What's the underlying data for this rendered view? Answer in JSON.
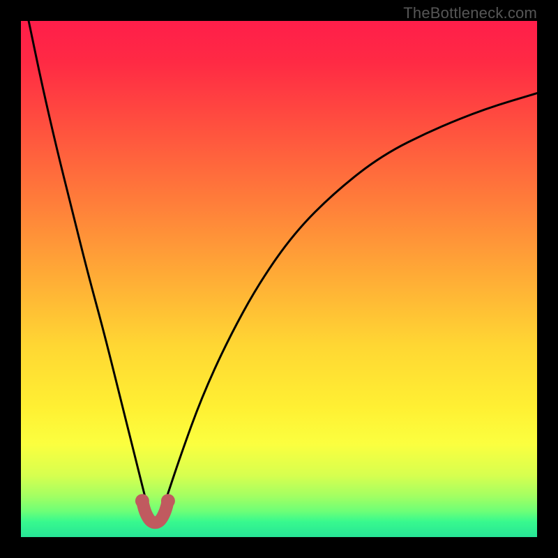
{
  "watermark": {
    "text": "TheBottleneck.com"
  },
  "chart_data": {
    "type": "line",
    "title": "",
    "xlabel": "",
    "ylabel": "",
    "x_range_pct": [
      0,
      100
    ],
    "y_range_pct": [
      0,
      100
    ],
    "minimum_x_pct": 26,
    "series": [
      {
        "name": "curve",
        "color": "#000000",
        "points_pct": [
          {
            "x": 1.5,
            "y": 100
          },
          {
            "x": 4,
            "y": 88
          },
          {
            "x": 7,
            "y": 75
          },
          {
            "x": 10,
            "y": 63
          },
          {
            "x": 13,
            "y": 51
          },
          {
            "x": 16,
            "y": 40
          },
          {
            "x": 19,
            "y": 28
          },
          {
            "x": 22,
            "y": 16
          },
          {
            "x": 24,
            "y": 8
          },
          {
            "x": 25,
            "y": 4
          },
          {
            "x": 26,
            "y": 3
          },
          {
            "x": 27,
            "y": 4
          },
          {
            "x": 28,
            "y": 7
          },
          {
            "x": 31,
            "y": 16
          },
          {
            "x": 35,
            "y": 27
          },
          {
            "x": 40,
            "y": 38
          },
          {
            "x": 46,
            "y": 49
          },
          {
            "x": 53,
            "y": 59
          },
          {
            "x": 61,
            "y": 67
          },
          {
            "x": 70,
            "y": 74
          },
          {
            "x": 80,
            "y": 79
          },
          {
            "x": 90,
            "y": 83
          },
          {
            "x": 100,
            "y": 86
          }
        ]
      },
      {
        "name": "trough-marker",
        "color": "#c05a5f",
        "thick": true,
        "points_pct": [
          {
            "x": 23.5,
            "y": 7
          },
          {
            "x": 24.0,
            "y": 5
          },
          {
            "x": 24.8,
            "y": 3.4
          },
          {
            "x": 25.6,
            "y": 2.8
          },
          {
            "x": 26.4,
            "y": 2.8
          },
          {
            "x": 27.2,
            "y": 3.4
          },
          {
            "x": 28.0,
            "y": 5
          },
          {
            "x": 28.5,
            "y": 7
          }
        ]
      }
    ],
    "gradient_stops": [
      {
        "offset": 0.0,
        "color": "#ff1e4a"
      },
      {
        "offset": 0.08,
        "color": "#ff2a44"
      },
      {
        "offset": 0.2,
        "color": "#ff4f3f"
      },
      {
        "offset": 0.35,
        "color": "#ff7d3a"
      },
      {
        "offset": 0.5,
        "color": "#ffad36"
      },
      {
        "offset": 0.63,
        "color": "#ffd733"
      },
      {
        "offset": 0.75,
        "color": "#fff033"
      },
      {
        "offset": 0.82,
        "color": "#fbff3f"
      },
      {
        "offset": 0.88,
        "color": "#d7ff4f"
      },
      {
        "offset": 0.92,
        "color": "#a4ff62"
      },
      {
        "offset": 0.95,
        "color": "#6dff77"
      },
      {
        "offset": 0.97,
        "color": "#38f98e"
      },
      {
        "offset": 1.0,
        "color": "#27e596"
      }
    ]
  }
}
